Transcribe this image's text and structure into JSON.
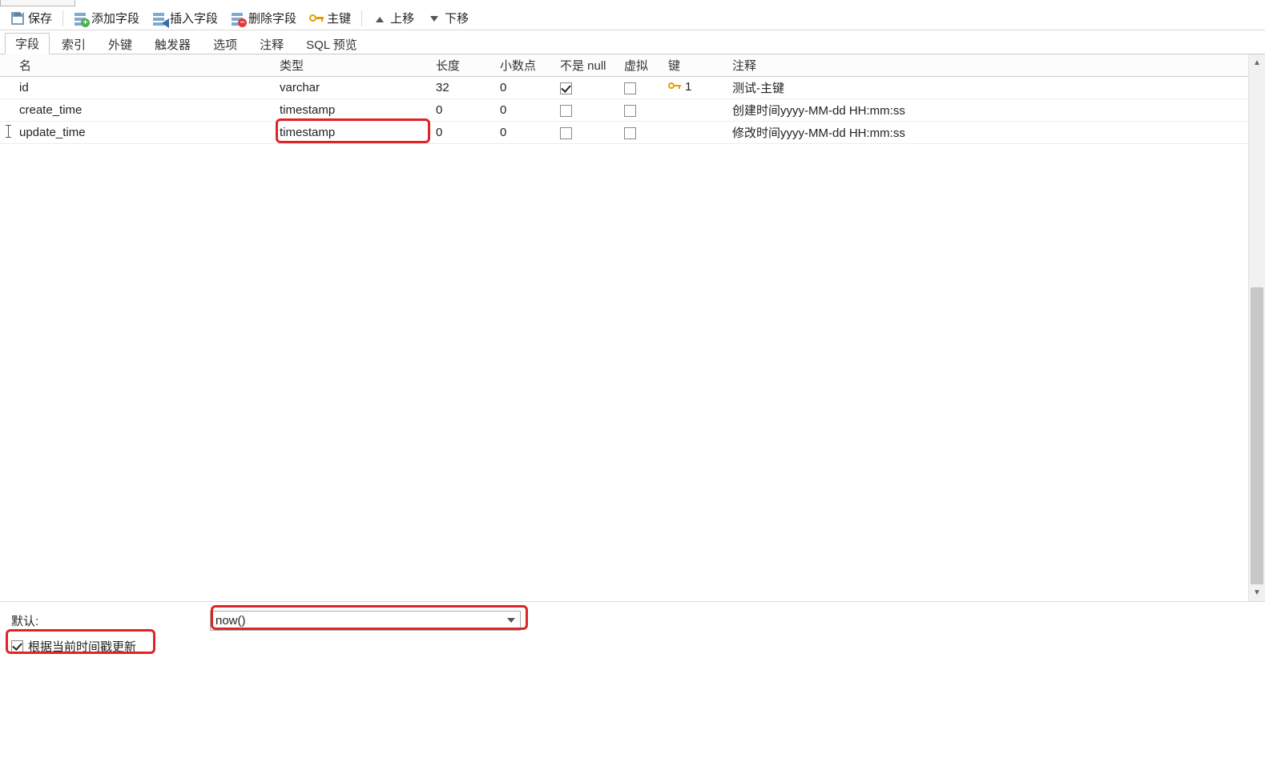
{
  "toolbar": {
    "save": "保存",
    "add_field": "添加字段",
    "insert_field": "插入字段",
    "delete_field": "删除字段",
    "primary_key": "主键",
    "move_up": "上移",
    "move_down": "下移"
  },
  "tabs": {
    "fields": "字段",
    "indexes": "索引",
    "foreign_keys": "外键",
    "triggers": "触发器",
    "options": "选项",
    "comment": "注释",
    "sql_preview": "SQL 预览",
    "active": "fields"
  },
  "grid": {
    "headers": {
      "name": "名",
      "type": "类型",
      "length": "长度",
      "decimal": "小数点",
      "not_null": "不是 null",
      "virtual": "虚拟",
      "key": "键",
      "comment": "注释"
    },
    "rows": [
      {
        "name": "id",
        "type": "varchar",
        "length": "32",
        "decimal": "0",
        "not_null": true,
        "virtual": false,
        "key": "1",
        "comment": "测试-主键"
      },
      {
        "name": "create_time",
        "type": "timestamp",
        "length": "0",
        "decimal": "0",
        "not_null": false,
        "virtual": false,
        "key": "",
        "comment": "创建时间yyyy-MM-dd HH:mm:ss"
      },
      {
        "name": "update_time",
        "type": "timestamp",
        "length": "0",
        "decimal": "0",
        "not_null": false,
        "virtual": false,
        "key": "",
        "comment": "修改时间yyyy-MM-dd HH:mm:ss"
      }
    ],
    "selected_row_index": 2
  },
  "bottom": {
    "default_label": "默认:",
    "default_value": "now()",
    "on_update_ts_label": "根据当前时间戳更新",
    "on_update_ts_checked": true
  }
}
